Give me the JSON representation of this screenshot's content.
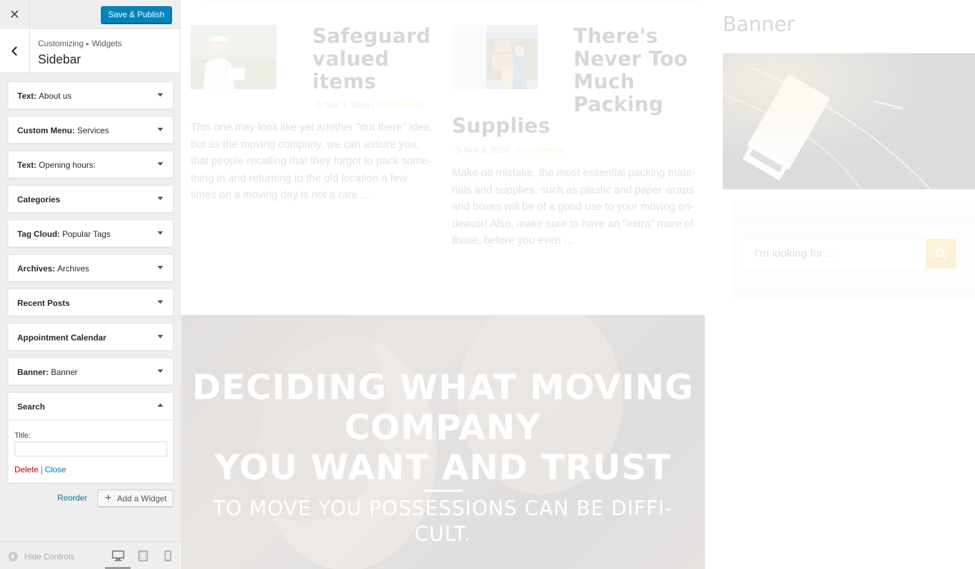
{
  "customizer": {
    "close_glyph": "✕",
    "save_label": "Save & Publish",
    "breadcrumb": {
      "root": "Customizing",
      "separator": "▸",
      "current": "Widgets"
    },
    "section_title": "Sidebar",
    "widgets": [
      {
        "type": "Text",
        "name": "About us"
      },
      {
        "type": "Custom Menu",
        "name": "Services"
      },
      {
        "type": "Text",
        "name": "Opening hours:"
      },
      {
        "type": "Categories",
        "name": ""
      },
      {
        "type": "Tag Cloud",
        "name": "Popular Tags"
      },
      {
        "type": "Archives",
        "name": "Archives"
      },
      {
        "type": "Recent Posts",
        "name": ""
      },
      {
        "type": "Appointment Calendar",
        "name": ""
      },
      {
        "type": "Banner",
        "name": "Banner"
      },
      {
        "type": "Search",
        "name": ""
      }
    ],
    "search_widget": {
      "title_label": "Title:",
      "title_value": "",
      "delete_label": "Delete",
      "pipe": "|",
      "close_label": "Close"
    },
    "reorder_label": "Reorder",
    "add_widget_label": "Add a Widget",
    "add_widget_glyph": "+",
    "hide_controls_label": "Hide Controls",
    "colors": {
      "primary": "#0085ba",
      "link": "#0073aa",
      "delete": "#aa0000"
    }
  },
  "preview": {
    "posts": [
      {
        "title": [
          "Safeguard",
          "valued",
          "items"
        ],
        "date": "Nov 3, 2016",
        "comments": "0 Comments",
        "excerpt": [
          "This one may look like yet another \"out there\" idea,",
          "but as the moving company, we can assure you,",
          "that people recalling that they forgot to pack some-",
          "thing in and returning to the old location a few",
          "times on a moving day is not a rare ..."
        ]
      },
      {
        "title": [
          "There's",
          "Never Too",
          "Much",
          "Packing"
        ],
        "title_tail": "Supplies",
        "date": "Nov 3, 2016",
        "comments": "0 Comments",
        "excerpt": [
          "Make no mistake, the most essential packing mate-",
          "rials and supplies, such as plastic and paper wraps",
          "and boxes will be of a good use to your moving en-",
          "deavor! Also, make sure to have an \"extra\" more of",
          "those, before you even ..."
        ]
      }
    ],
    "hero": {
      "headline": [
        "DECIDING WHAT MOVING",
        "COMPANY",
        "YOU WANT AND TRUST"
      ],
      "subline": [
        "TO MOVE YOU POSSESSIONS CAN BE DIFFI-",
        "CULT."
      ]
    },
    "banner_title": "Banner",
    "search_placeholder": "I'm looking for ...",
    "accent": "#f0b429"
  }
}
